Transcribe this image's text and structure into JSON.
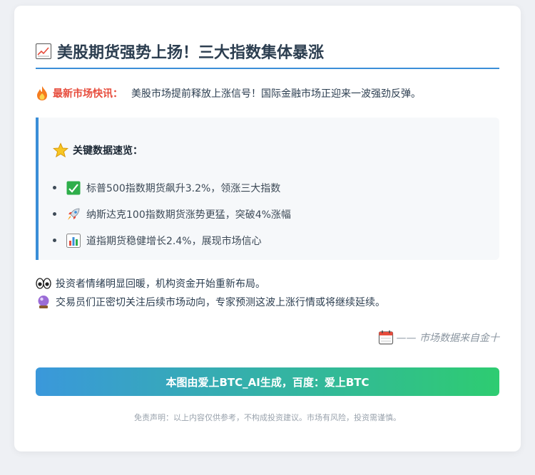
{
  "title": "美股期货强势上扬！三大指数集体暴涨",
  "flash": {
    "label": "最新市场快讯：",
    "text": "美股市场提前释放上涨信号！国际金融市场正迎来一波强劲反弹。"
  },
  "panel": {
    "heading": "关键数据速览：",
    "items": [
      {
        "icon": "check-chart-icon",
        "text": "标普500指数期货飙升3.2%，领涨三大指数"
      },
      {
        "icon": "rocket-icon",
        "text": "纳斯达克100指数期货涨势更猛，突破4%涨幅"
      },
      {
        "icon": "bar-chart-icon",
        "text": "道指期货稳健增长2.4%，展现市场信心"
      }
    ]
  },
  "notes": [
    {
      "icon": "eyes-icon",
      "text": "投资者情绪明显回暖，机构资金开始重新布局。"
    },
    {
      "icon": "crystal-ball-icon",
      "text": "交易员们正密切关注后续市场动向，专家预测这波上涨行情或将继续延续。"
    }
  ],
  "source": "—— 市场数据来自金十",
  "banner": "本图由爱上BTC_AI生成，百度：爱上BTC",
  "disclaimer": "免责声明：以上内容仅供参考，不构成投资建议。市场有风险，投资需谨慎。",
  "colors": {
    "accent": "#3a8ed8",
    "flash_label": "#e74c3c",
    "banner_start": "#3a98db",
    "banner_end": "#2ecc71"
  }
}
